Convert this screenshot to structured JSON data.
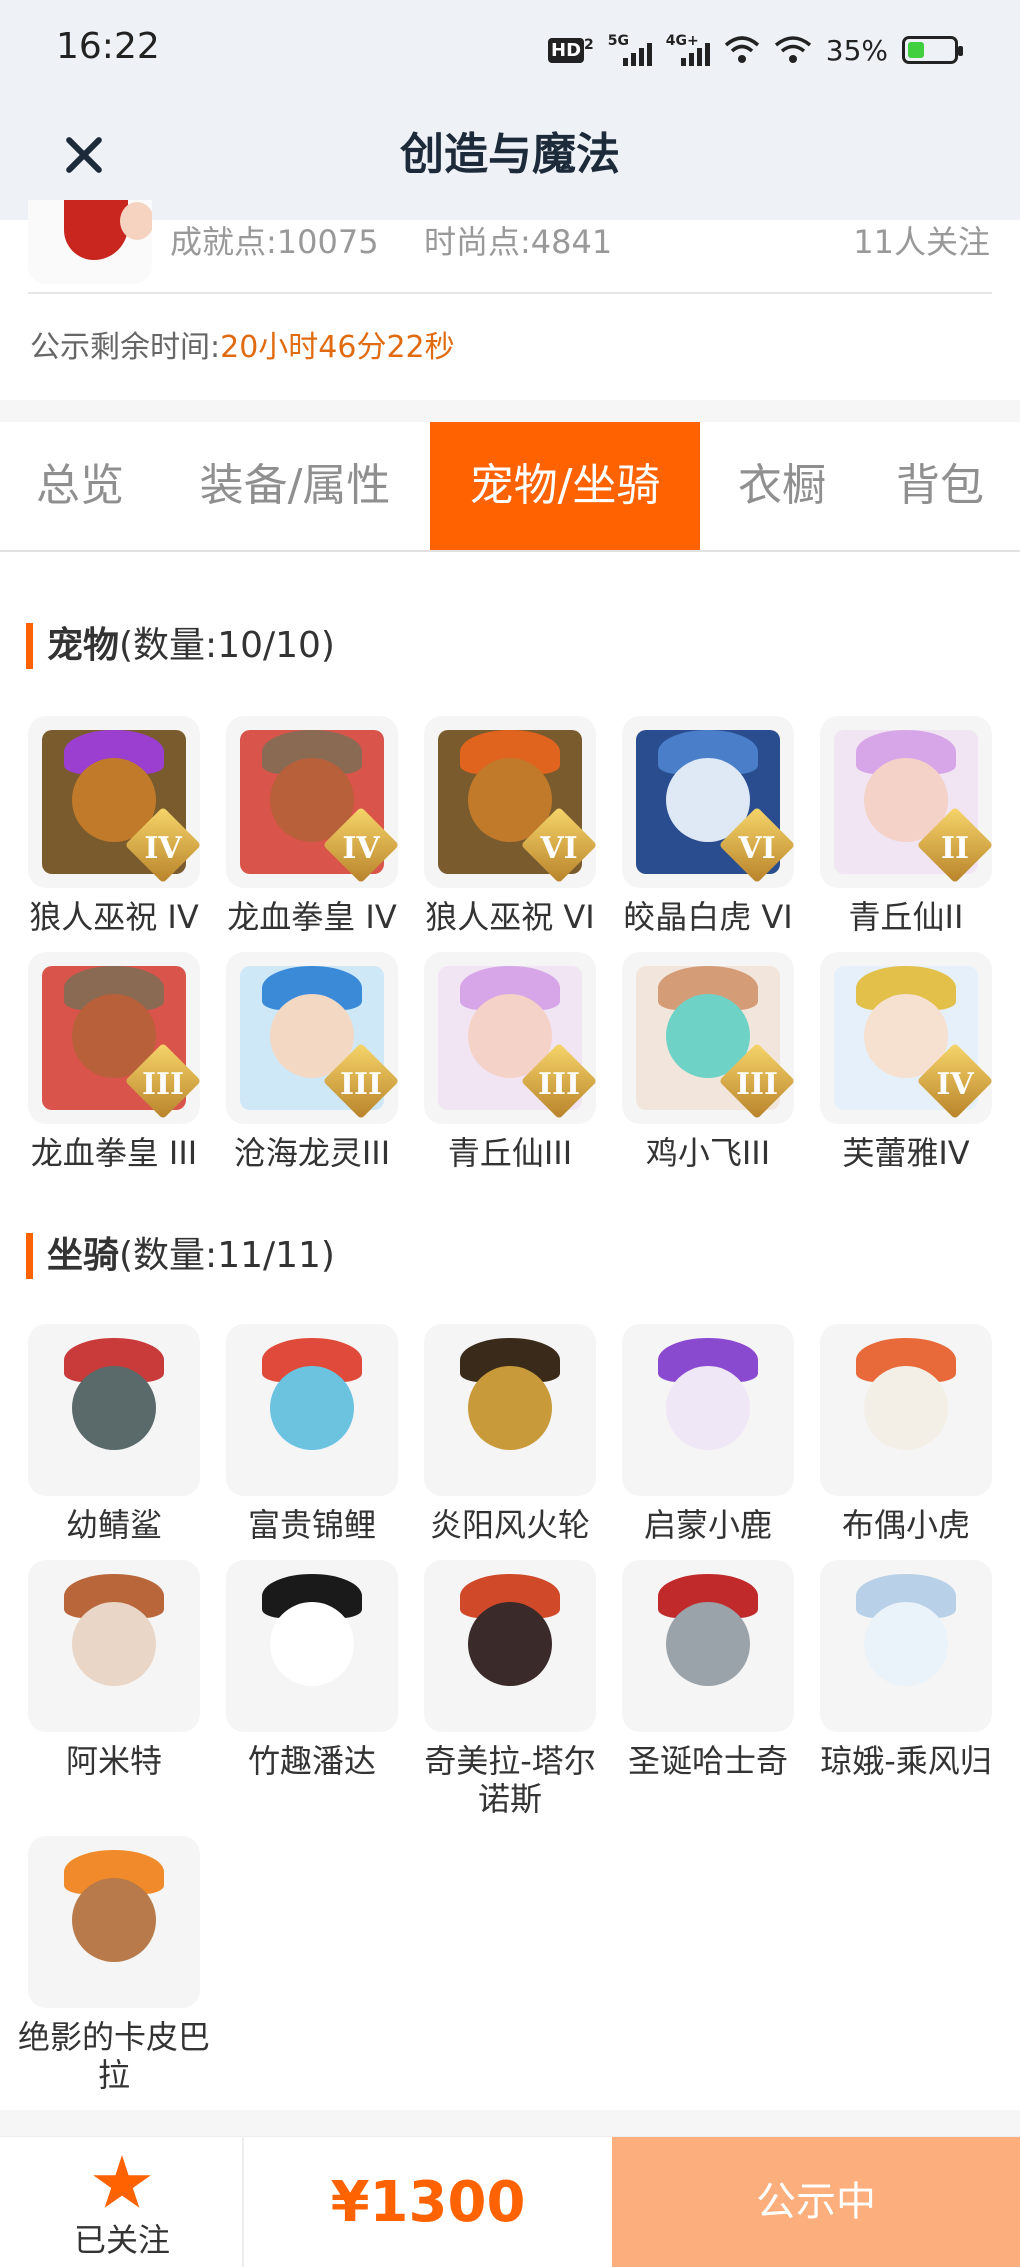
{
  "status_bar": {
    "time": "16:22",
    "hd": "HD",
    "sub": "2",
    "net1": "5G",
    "net2": "4G+",
    "battery": "35%"
  },
  "nav": {
    "title": "创造与魔法"
  },
  "profile": {
    "achievement": "成就点:10075",
    "fashion": "时尚点:4841",
    "followers": "11人关注",
    "countdown_label": "公示剩余时间:",
    "countdown_value": "20小时46分22秒"
  },
  "tabs": [
    "总览",
    "装备/属性",
    "宠物/坐骑",
    "衣橱",
    "背包"
  ],
  "active_tab": 2,
  "pets": {
    "title": "宠物",
    "count": "(数量:10/10)",
    "items": [
      {
        "name": "狼人巫祝 IV",
        "rank": "IV",
        "palette": [
          "#7a5b2e",
          "#c07a2a",
          "#9b3fd0"
        ]
      },
      {
        "name": "龙血拳皇 IV",
        "rank": "IV",
        "palette": [
          "#d9544a",
          "#b8603a",
          "#8a6a52"
        ]
      },
      {
        "name": "狼人巫祝 VI",
        "rank": "VI",
        "palette": [
          "#7a5b2e",
          "#c07a2a",
          "#e0641e"
        ]
      },
      {
        "name": "皎晶白虎 VI",
        "rank": "VI",
        "palette": [
          "#2a4d8f",
          "#dfe8f5",
          "#4a7ec8"
        ]
      },
      {
        "name": "青丘仙II",
        "rank": "II",
        "palette": [
          "#f1e4f3",
          "#f4d2c8",
          "#d7a6e8"
        ]
      },
      {
        "name": "龙血拳皇 III",
        "rank": "III",
        "palette": [
          "#d9544a",
          "#b8603a",
          "#8a6a52"
        ]
      },
      {
        "name": "沧海龙灵III",
        "rank": "III",
        "palette": [
          "#cfe8f8",
          "#f3d8c4",
          "#3a8ad8"
        ]
      },
      {
        "name": "青丘仙III",
        "rank": "III",
        "palette": [
          "#f1e4f3",
          "#f4d2c8",
          "#d7a6e8"
        ]
      },
      {
        "name": "鸡小飞III",
        "rank": "III",
        "palette": [
          "#f2e6dc",
          "#6fd2c6",
          "#d59c78"
        ]
      },
      {
        "name": "芙蕾雅IV",
        "rank": "IV",
        "palette": [
          "#e6f0fa",
          "#f6e0cf",
          "#e2c04a"
        ]
      }
    ]
  },
  "mounts": {
    "title": "坐骑",
    "count": "(数量:11/11)",
    "items": [
      {
        "name": "幼鲭鲨",
        "palette": [
          "#f5f5f5",
          "#5a6a6a",
          "#c93a3a"
        ]
      },
      {
        "name": "富贵锦鲤",
        "palette": [
          "#f5f5f5",
          "#6cc3e0",
          "#e04a3a"
        ]
      },
      {
        "name": "炎阳风火轮",
        "palette": [
          "#f5f5f5",
          "#c89a3a",
          "#3a2a1a"
        ]
      },
      {
        "name": "启蒙小鹿",
        "palette": [
          "#f5f5f5",
          "#efe7f5",
          "#8a4ad0"
        ]
      },
      {
        "name": "布偶小虎",
        "palette": [
          "#f5f5f5",
          "#f3efe6",
          "#e86a3a"
        ]
      },
      {
        "name": "阿米特",
        "palette": [
          "#f5f5f5",
          "#e9d6c6",
          "#b8663a"
        ]
      },
      {
        "name": "竹趣潘达",
        "palette": [
          "#f5f5f5",
          "#ffffff",
          "#1a1a1a"
        ]
      },
      {
        "name": "奇美拉-塔尔诺斯",
        "palette": [
          "#f5f5f5",
          "#3a2a2a",
          "#d04a2a"
        ]
      },
      {
        "name": "圣诞哈士奇",
        "palette": [
          "#f5f5f5",
          "#9aa2aa",
          "#c02a2a"
        ]
      },
      {
        "name": "琼娥-乘风归",
        "palette": [
          "#f5f5f5",
          "#eaf2fa",
          "#b8d0e8"
        ]
      },
      {
        "name": "绝影的卡皮巴拉",
        "palette": [
          "#f5f5f5",
          "#b87a4a",
          "#f08a2a"
        ]
      }
    ]
  },
  "bottom_bar": {
    "follow_label": "已关注",
    "price": "¥1300",
    "action": "公示中"
  },
  "colors": {
    "accent": "#ff6200",
    "countdown": "#e06b10",
    "action_bg": "#fcae7c"
  }
}
